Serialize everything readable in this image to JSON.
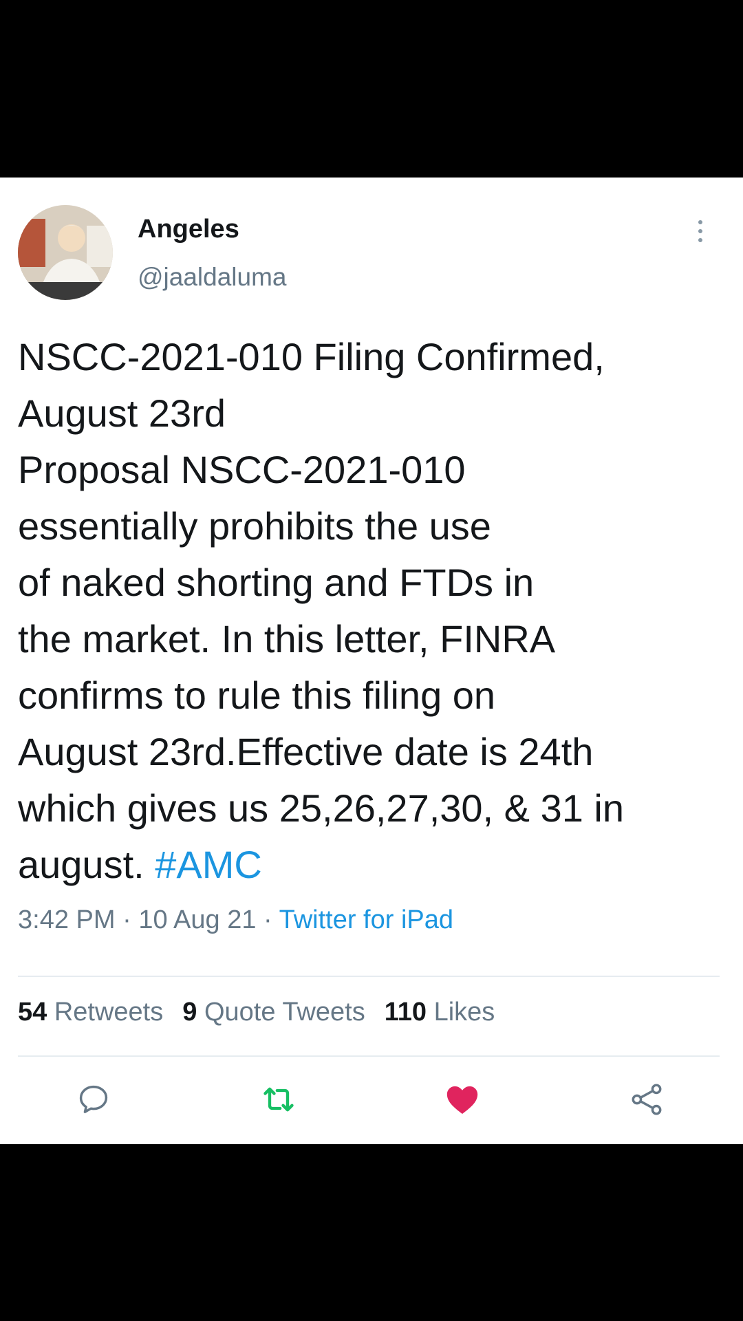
{
  "user": {
    "name": "Angeles",
    "handle": "@jaaldaluma"
  },
  "tweet": {
    "text": "NSCC-2021-010 Filing Confirmed,\nAugust 23rd\nProposal NSCC-2021-010\nessentially prohibits the use\nof naked shorting and FTDs in\nthe market. In this letter, FINRA\nconfirms to rule this filing on\nAugust 23rd.Effective date is 24th\nwhich gives us 25,26,27,30, & 31 in\naugust. ",
    "hashtag": "#AMC"
  },
  "meta": {
    "time": "3:42 PM",
    "separator1": " · ",
    "date": "10 Aug 21",
    "separator2": " · ",
    "source": "Twitter for iPad"
  },
  "stats": {
    "retweets_count": "54",
    "retweets_label": " Retweets",
    "quotes_count": "9",
    "quotes_label": " Quote Tweets",
    "likes_count": "110",
    "likes_label": " Likes"
  },
  "actions": {
    "reply_icon": "reply-icon",
    "retweet_icon": "retweet-icon",
    "like_icon": "heart-icon",
    "share_icon": "share-icon"
  },
  "colors": {
    "link": "#1b95e0",
    "retweet": "#17bf63",
    "like": "#e0245e",
    "secondary": "#657786"
  }
}
